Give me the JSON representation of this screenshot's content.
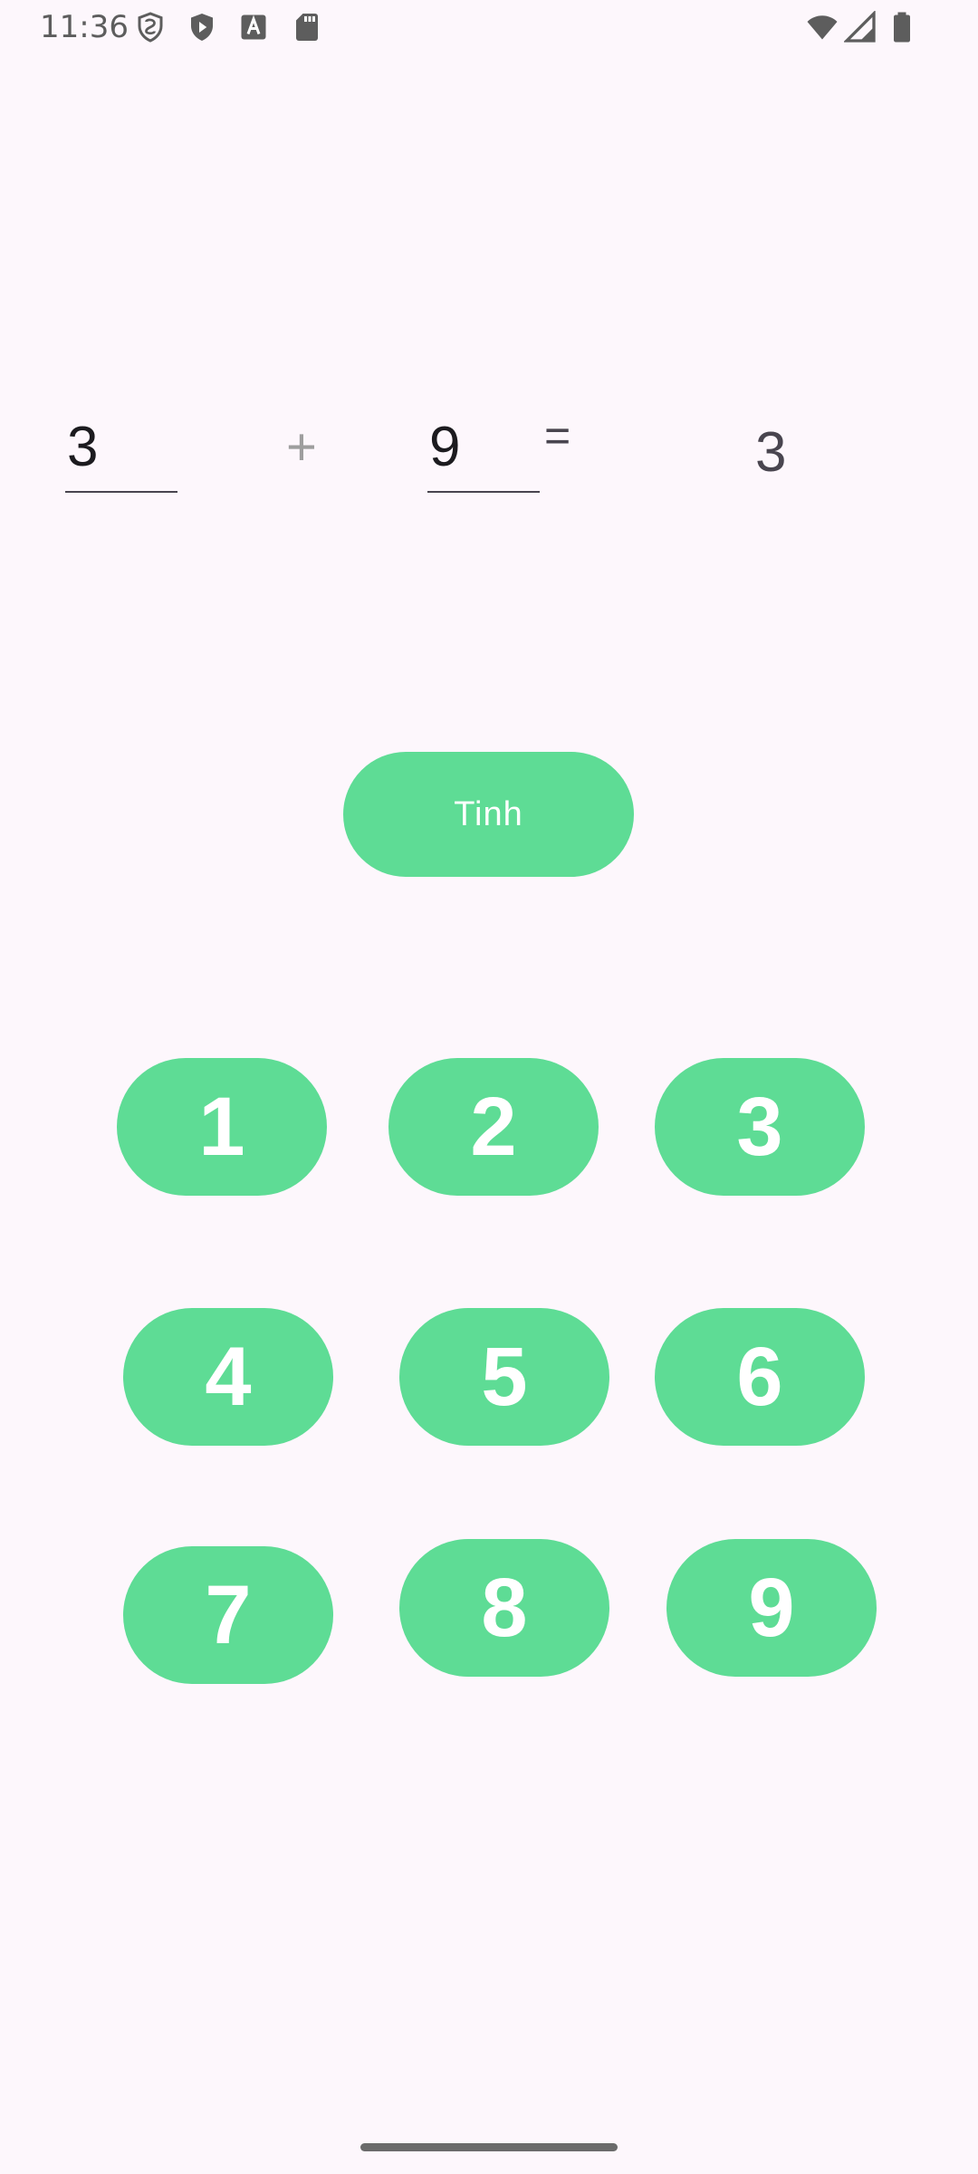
{
  "status_bar": {
    "time": "11:36",
    "left_icons": [
      "shield-vpn-icon",
      "play-protect-icon",
      "font-a-icon",
      "sd-card-icon"
    ],
    "right_icons": [
      "wifi-icon",
      "signal-icon",
      "battery-icon"
    ]
  },
  "calculator": {
    "operand_a": "3",
    "operator": "+",
    "operand_b": "9",
    "equals": "=",
    "result": "3",
    "calc_button_label": "Tinh"
  },
  "keypad": {
    "keys": [
      "1",
      "2",
      "3",
      "4",
      "5",
      "6",
      "7",
      "8",
      "9"
    ]
  },
  "colors": {
    "background": "#FDF7FC",
    "button": "#5EDC95",
    "button_text": "#FFFFFF"
  }
}
